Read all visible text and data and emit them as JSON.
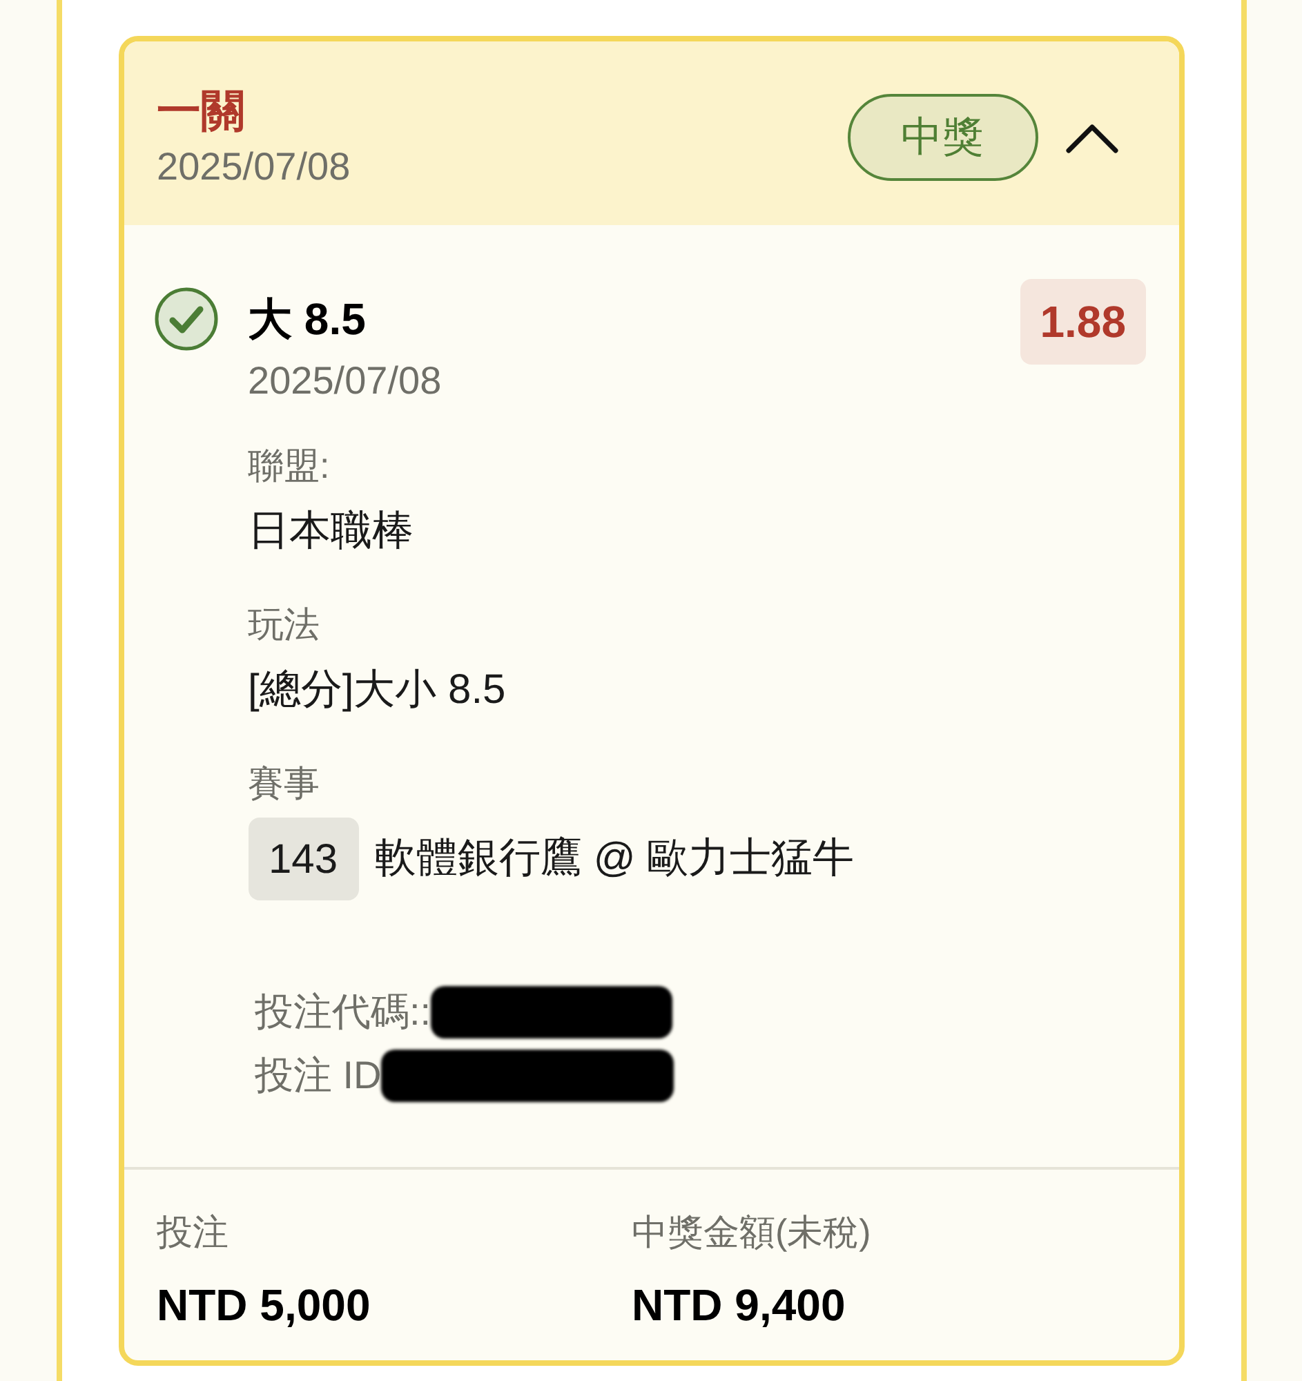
{
  "card": {
    "title": "一關",
    "date": "2025/07/08",
    "status_badge": "中獎",
    "expanded": true,
    "bet": {
      "won": true,
      "selection": "大 8.5",
      "date": "2025/07/08",
      "odds": "1.88",
      "fields": [
        {
          "kind": "text",
          "label": "聯盟:",
          "value": "日本職棒"
        },
        {
          "kind": "text",
          "label": "玩法",
          "value": "[總分]大小 8.5"
        },
        {
          "kind": "match",
          "label": "賽事",
          "match_number": "143",
          "value": "軟體銀行鷹 @ 歐力士猛牛"
        }
      ],
      "references": [
        {
          "label": "投注代碼::",
          "redacted": true
        },
        {
          "label": "投注 ID",
          "redacted": true
        }
      ]
    },
    "summary": [
      {
        "label": "投注",
        "value": "NTD 5,000"
      },
      {
        "label": "中獎金額(未稅)",
        "value": "NTD 9,400"
      }
    ]
  }
}
